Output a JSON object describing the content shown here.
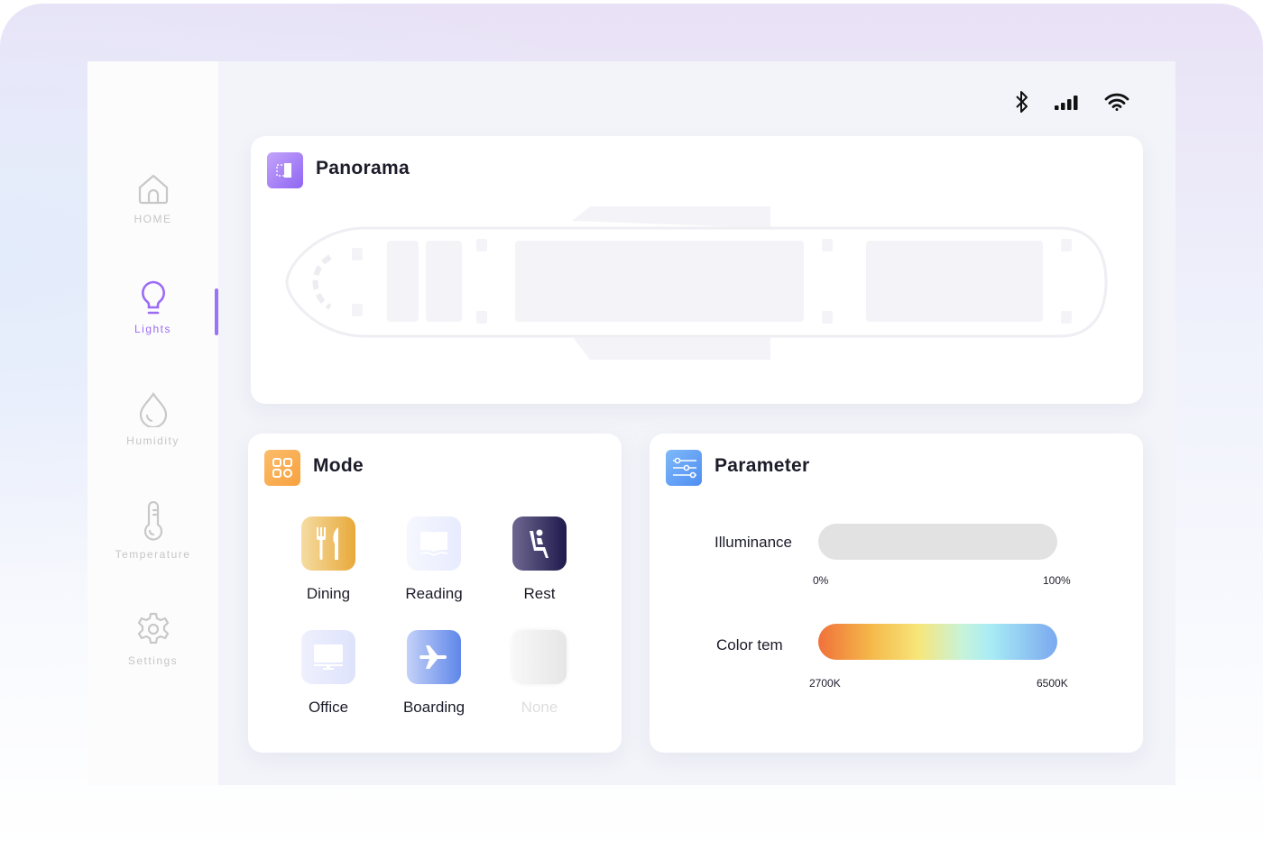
{
  "sidebar": {
    "items": [
      {
        "label": "HOME",
        "icon": "home-icon",
        "active": false
      },
      {
        "label": "Lights",
        "icon": "lightbulb-icon",
        "active": true
      },
      {
        "label": "Humidity",
        "icon": "droplet-icon",
        "active": false
      },
      {
        "label": "Temperature",
        "icon": "thermometer-icon",
        "active": false
      },
      {
        "label": "Settings",
        "icon": "gear-icon",
        "active": false
      }
    ]
  },
  "status": {
    "icons": [
      "bluetooth-icon",
      "signal-icon",
      "wifi-icon"
    ]
  },
  "panorama": {
    "title": "Panorama"
  },
  "mode": {
    "title": "Mode",
    "items": [
      {
        "label": "Dining",
        "icon": "fork-knife-icon"
      },
      {
        "label": "Reading",
        "icon": "book-icon"
      },
      {
        "label": "Rest",
        "icon": "seat-icon"
      },
      {
        "label": "Office",
        "icon": "monitor-icon"
      },
      {
        "label": "Boarding",
        "icon": "airplane-icon"
      },
      {
        "label": "None",
        "icon": "blank-icon"
      }
    ]
  },
  "parameter": {
    "title": "Parameter",
    "illuminance": {
      "label": "Illuminance",
      "min": "0%",
      "max": "100%"
    },
    "color_temp": {
      "label": "Color tem",
      "min": "2700K",
      "max": "6500K"
    }
  },
  "colors": {
    "accent": "#9b6bf5",
    "mode_icon": "#f7a74a",
    "param_icon": "#5b9cf5"
  }
}
